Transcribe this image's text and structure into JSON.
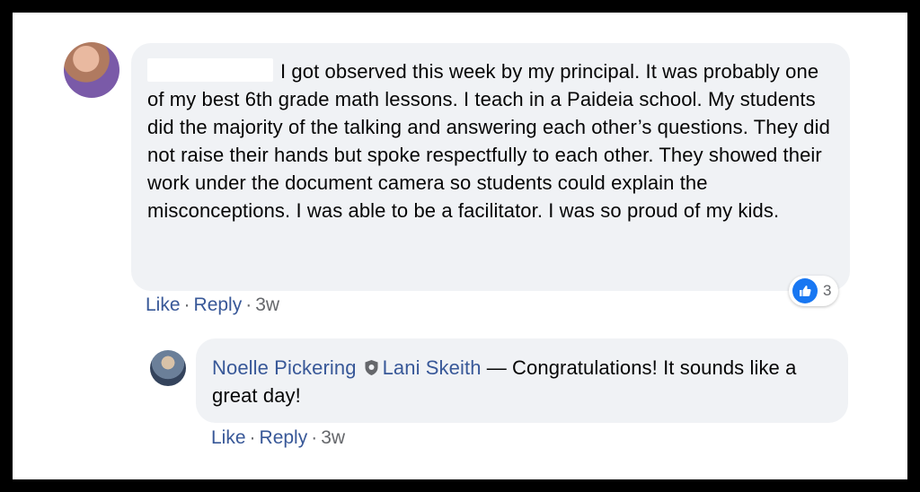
{
  "comment": {
    "author_name": "",
    "text": "I got observed this week by my principal. It was probably one of my best 6th grade math lessons. I teach in a Paideia school. My students did the majority of the talking and answering each other’s questions. They did not raise their hands but spoke respectfully to each other. They showed their work under the document camera so students could explain the misconceptions. I was able to be a facilitator. I was so proud of my kids.",
    "actions": {
      "like": "Like",
      "reply": "Reply",
      "time": "3w"
    },
    "reaction": {
      "icon": "thumbs-up-icon",
      "count": "3",
      "color": "#1877f2"
    }
  },
  "reply": {
    "author_name": "Noelle Pickering",
    "badge_icon": "shield-icon",
    "mention": "Lani Skeith",
    "text": " — Congratulations! It sounds like a great day!",
    "actions": {
      "like": "Like",
      "reply": "Reply",
      "time": "3w"
    }
  },
  "colors": {
    "link": "#385898",
    "bubble": "#f0f2f5",
    "meta": "#65676b"
  }
}
